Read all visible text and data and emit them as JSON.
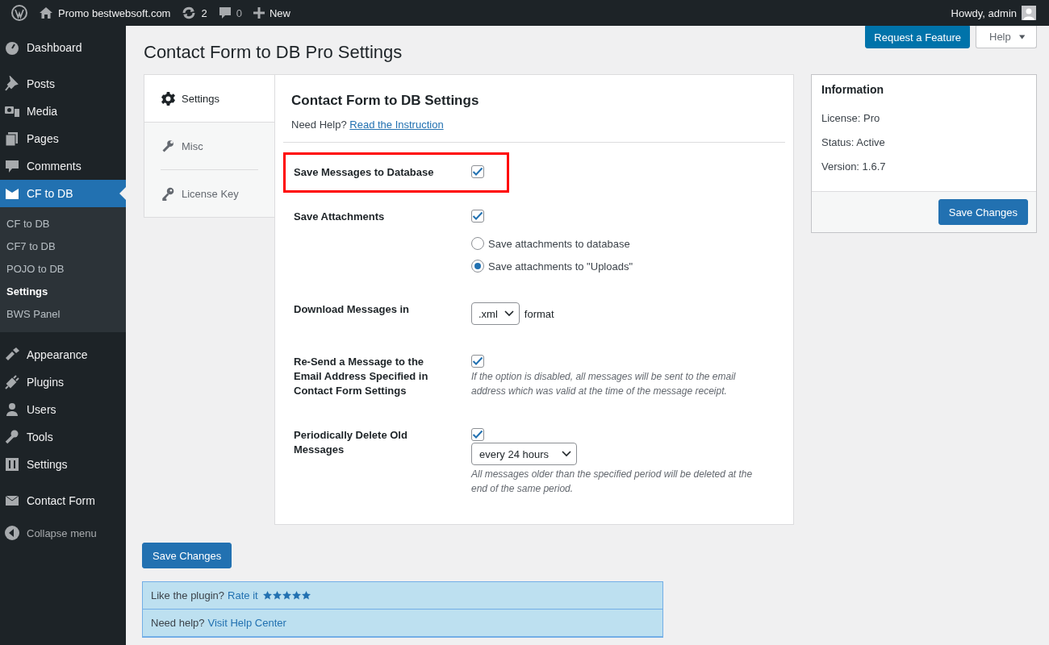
{
  "admin_bar": {
    "site": "Promo bestwebsoft.com",
    "updates": "2",
    "comments": "0",
    "new": "New",
    "greeting": "Howdy, admin"
  },
  "sidebar": {
    "groups": [
      {
        "items": [
          {
            "label": "Dashboard",
            "selected": false
          }
        ]
      },
      {
        "items": [
          {
            "label": "Posts",
            "selected": false
          },
          {
            "label": "Media",
            "selected": false
          },
          {
            "label": "Pages",
            "selected": false
          },
          {
            "label": "Comments",
            "selected": false
          },
          {
            "label": "CF to DB",
            "selected": true,
            "children": [
              {
                "label": "CF to DB",
                "selected": false
              },
              {
                "label": "CF7 to DB",
                "selected": false
              },
              {
                "label": "POJO to DB",
                "selected": false
              },
              {
                "label": "Settings",
                "selected": true
              },
              {
                "label": "BWS Panel",
                "selected": false
              }
            ]
          }
        ]
      },
      {
        "items": [
          {
            "label": "Appearance",
            "selected": false
          },
          {
            "label": "Plugins",
            "selected": false
          },
          {
            "label": "Users",
            "selected": false
          },
          {
            "label": "Tools",
            "selected": false
          },
          {
            "label": "Settings",
            "selected": false
          }
        ]
      },
      {
        "items": [
          {
            "label": "Contact Form",
            "selected": false
          }
        ]
      }
    ],
    "collapse": "Collapse menu"
  },
  "header_buttons": {
    "feature": "Request a Feature",
    "help": "Help"
  },
  "page_title": "Contact Form to DB Pro Settings",
  "tabs": [
    {
      "label": "Settings",
      "selected": true
    },
    {
      "label": "Misc",
      "selected": false
    },
    {
      "label": "License Key",
      "selected": false
    }
  ],
  "panel": {
    "title": "Contact Form to DB Settings",
    "help_text": "Need Help?",
    "help_link": "Read the Instruction",
    "rows": [
      {
        "kind": "checkbox",
        "label": "Save Messages to Database",
        "checked": true,
        "highlighted": true
      },
      {
        "kind": "checkbox",
        "label": "Save Attachments",
        "checked": true,
        "highlighted": false,
        "options": [
          {
            "label": "Save attachments to database",
            "selected": false
          },
          {
            "label": "Save attachments to \"Uploads\"",
            "selected": true
          }
        ]
      },
      {
        "kind": "select",
        "label": "Download Messages in",
        "value": ".xml",
        "suffix": "format",
        "highlighted": false
      },
      {
        "kind": "checkbox",
        "label": "Re-Send a Message to the Email Address Specified in Contact Form Settings",
        "checked": true,
        "highlighted": false,
        "note": "If the option is disabled, all messages will be sent to the email address which was valid at the time of the message receipt."
      },
      {
        "kind": "checkbox",
        "label": "Periodically Delete Old Messages",
        "checked": true,
        "highlighted": false,
        "select": "every 24 hours",
        "note": "All messages older than the specified period will be deleted at the end of the same period."
      }
    ]
  },
  "save_button": "Save Changes",
  "notice": [
    {
      "text": "Like the plugin?",
      "link": "Rate it",
      "stars": 5
    },
    {
      "text": "Need help?",
      "link": "Visit Help Center"
    }
  ],
  "info": {
    "title": "Information",
    "lines": [
      "License: Pro",
      "Status: Active",
      "Version: 1.6.7"
    ],
    "button": "Save Changes"
  }
}
